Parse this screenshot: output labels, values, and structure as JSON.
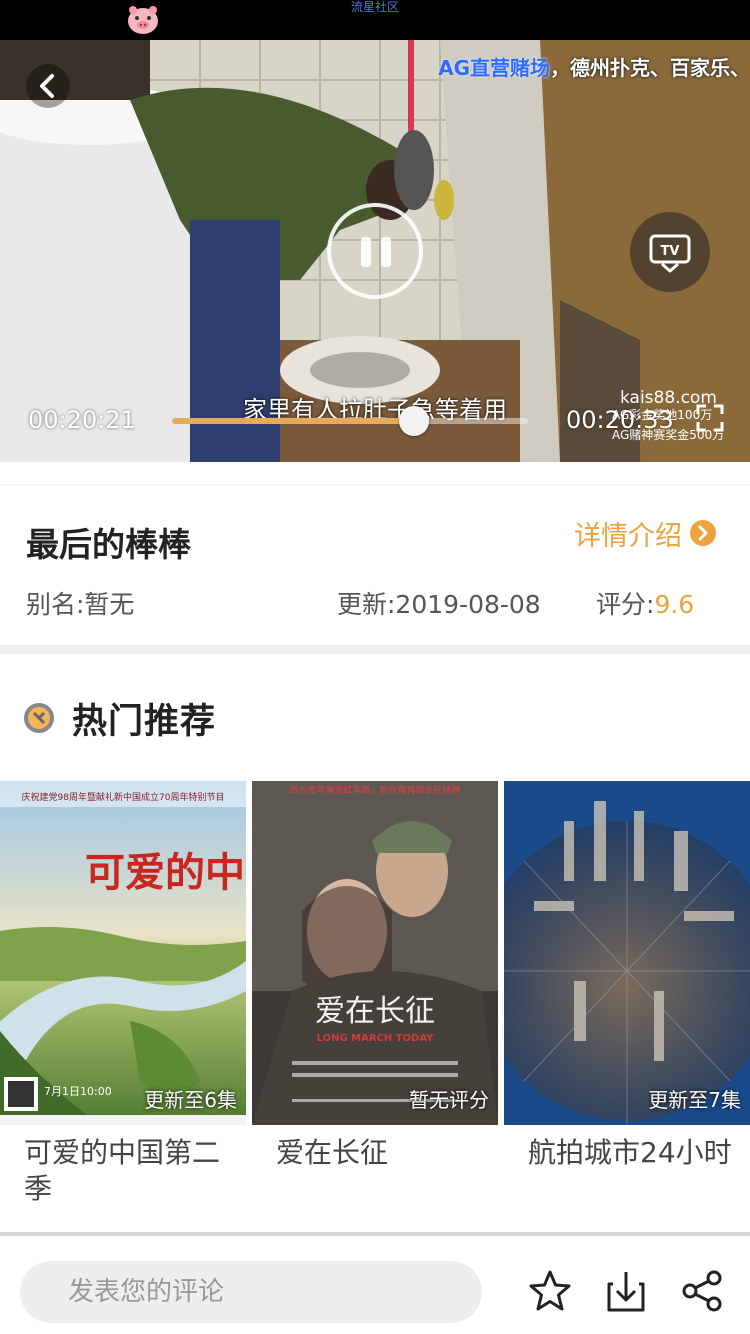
{
  "status_bar": {
    "app_name": "流星社区"
  },
  "player": {
    "ad_banner_brand": "AG直营赌场",
    "ad_banner_rest": "，德州扑克、百家乐、",
    "subtitle": "家里有人拉肚子急等着用",
    "current_time": "00:20:21",
    "total_time": "00:20:33",
    "progress": 0.68,
    "watermark_domain": "kais88.com",
    "watermark_line1": "AG彩金奖池100万",
    "watermark_line2": "AG赌神赛奖金500万",
    "progress_color": "#e9a95a"
  },
  "info": {
    "title": "最后的棒棒",
    "detail_link": "详情介绍",
    "alias": "别名:暂无",
    "updated": "更新:2019-08-08",
    "rating_label": "评分:",
    "rating_value": "9.6",
    "accent_color": "#eda23e"
  },
  "recommend": {
    "section_title": "热门推荐",
    "items": [
      {
        "title": "可爱的中国第二季",
        "badge": "更新至6集",
        "poster_text": "可爱的中国",
        "poster_header": "庆祝建党98周年暨献礼新中国成立70周年特别节目",
        "poster_date": "7月1日10:00"
      },
      {
        "title": "爱在长征",
        "badge": "暂无评分",
        "poster_text": "爱在长征",
        "poster_header": "西方青年重走红军路，新视角再现长征精神",
        "poster_subtitle": "LONG MARCH TODAY"
      },
      {
        "title": "航拍城市24小时",
        "badge": "更新至7集"
      }
    ]
  },
  "bottom_bar": {
    "comment_placeholder": "发表您的评论",
    "icons": [
      "star-icon",
      "download-icon",
      "share-icon"
    ]
  }
}
